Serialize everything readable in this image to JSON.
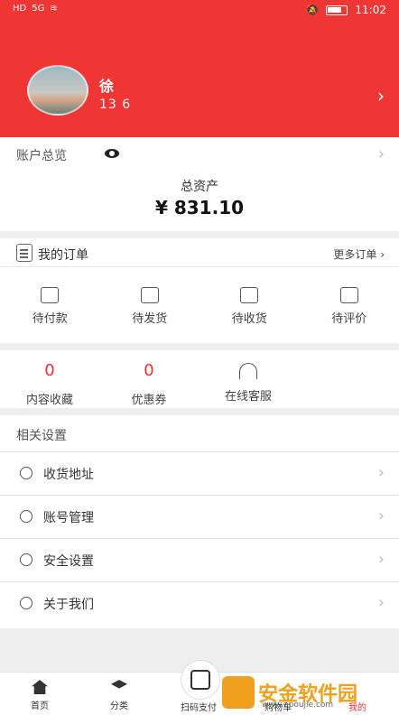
{
  "status_bar": {
    "time": "11:02",
    "carrier_hd": "HD",
    "network": "5G"
  },
  "header": {
    "user_name": "徐",
    "phone": "13          6"
  },
  "account": {
    "title": "账户总览",
    "asset_label": "总资产",
    "asset_value": "¥ 831.10"
  },
  "orders": {
    "title": "我的订单",
    "more": "更多订单",
    "items": [
      {
        "label": "待付款"
      },
      {
        "label": "待发货"
      },
      {
        "label": "待收货"
      },
      {
        "label": "待评价"
      }
    ]
  },
  "stats": [
    {
      "value": "0",
      "label": "内容收藏"
    },
    {
      "value": "0",
      "label": "优惠券"
    },
    {
      "value": "",
      "label": "在线客服"
    }
  ],
  "settings": {
    "title": "相关设置",
    "rows": [
      {
        "label": "收货地址"
      },
      {
        "label": "账号管理"
      },
      {
        "label": "安全设置"
      },
      {
        "label": "关于我们"
      }
    ]
  },
  "tabbar": {
    "tabs": [
      {
        "label": "首页"
      },
      {
        "label": "分类"
      },
      {
        "label": "扫码支付"
      },
      {
        "label": "购物车"
      },
      {
        "label": "我的"
      }
    ]
  },
  "watermark": {
    "text": "安金软件园",
    "sub": "www.apoujie.com"
  },
  "colors": {
    "primary": "#f03535",
    "accent": "#e53333",
    "watermark": "#f0a01e"
  }
}
